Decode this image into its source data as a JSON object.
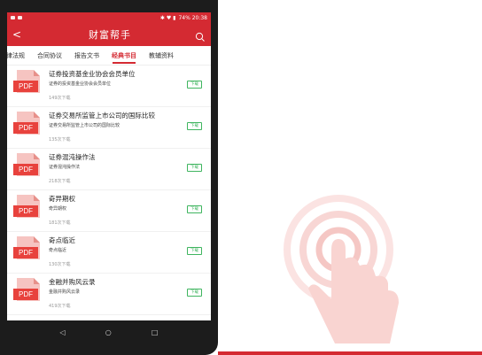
{
  "status": {
    "right_text": "74%  20:38"
  },
  "app": {
    "title": "财富帮手",
    "back_glyph": "<"
  },
  "tabs": [
    {
      "label": "律法规",
      "active": false
    },
    {
      "label": "合同协议",
      "active": false
    },
    {
      "label": "报告文书",
      "active": false
    },
    {
      "label": "经典书目",
      "active": true
    },
    {
      "label": "教辅资料",
      "active": false
    }
  ],
  "items": [
    {
      "badge": "PDF",
      "title": "证券投资基金业协会会员单位",
      "desc": "证券的投资基金业协会会员单位",
      "count": "149次下载",
      "download_label": "下载"
    },
    {
      "badge": "PDF",
      "title": "证券交易所监管上市公司的国际比较",
      "desc": "证券交易所监管上市公司的国际比较",
      "count": "135次下载",
      "download_label": "下载"
    },
    {
      "badge": "PDF",
      "title": "证券混沌操作法",
      "desc": "证券混沌操作法",
      "count": "218次下载",
      "download_label": "下载"
    },
    {
      "badge": "PDF",
      "title": "奇异期权",
      "desc": "奇异期权",
      "count": "181次下载",
      "download_label": "下载"
    },
    {
      "badge": "PDF",
      "title": "奇点临近",
      "desc": "奇点临近",
      "count": "130次下载",
      "download_label": "下载"
    },
    {
      "badge": "PDF",
      "title": "金融并购风云录",
      "desc": "金融并购风云录",
      "count": "419次下载",
      "download_label": "下载"
    }
  ],
  "navbar": {
    "back": "◁",
    "home": "○",
    "recent": "□"
  },
  "colors": {
    "brand": "#d42a32",
    "download": "#3fb55f"
  }
}
